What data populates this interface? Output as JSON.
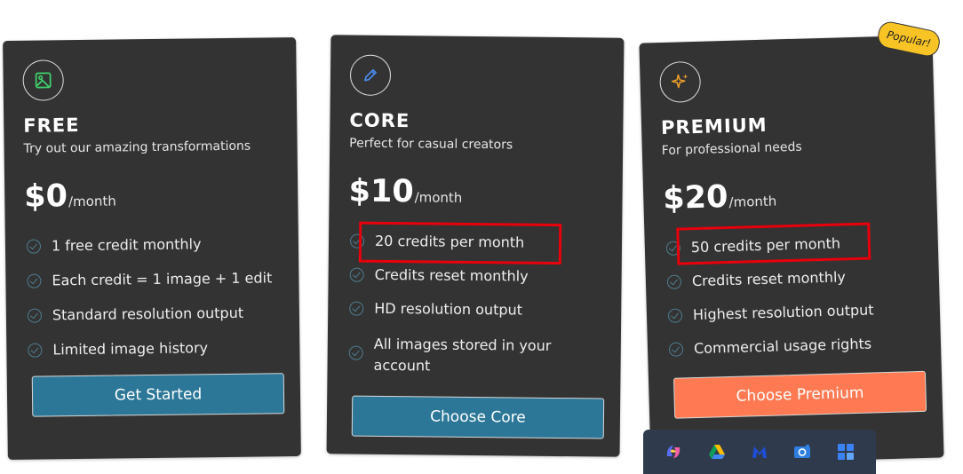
{
  "plans": {
    "free": {
      "icon": "image-icon",
      "name": "FREE",
      "tagline": "Try out our amazing transformations",
      "price": "$0",
      "period": "/month",
      "features": [
        "1 free credit monthly",
        "Each credit = 1 image + 1 edit",
        "Standard resolution output",
        "Limited image history"
      ],
      "cta": "Get Started"
    },
    "core": {
      "icon": "pencil-icon",
      "name": "CORE",
      "tagline": "Perfect for casual creators",
      "price": "$10",
      "period": "/month",
      "features": [
        "20 credits per month",
        "Credits reset monthly",
        "HD resolution output",
        "All images stored in your account"
      ],
      "cta": "Choose Core"
    },
    "premium": {
      "icon": "sparkles-icon",
      "name": "PREMIUM",
      "tagline": "For professional needs",
      "price": "$20",
      "period": "/month",
      "badge": "Popular!",
      "features": [
        "50 credits per month",
        "Credits reset monthly",
        "Highest resolution output",
        "Commercial usage rights"
      ],
      "cta": "Choose Premium"
    }
  },
  "taskbar": {
    "apps": [
      "copilot-icon",
      "google-drive-icon",
      "malwarebytes-icon",
      "camera-icon",
      "widgets-icon"
    ]
  },
  "colors": {
    "card_bg": "#333333",
    "primary_button": "#2c7797",
    "premium_button": "#ff7a52",
    "highlight": "#e8000b",
    "badge": "#f7c325"
  }
}
